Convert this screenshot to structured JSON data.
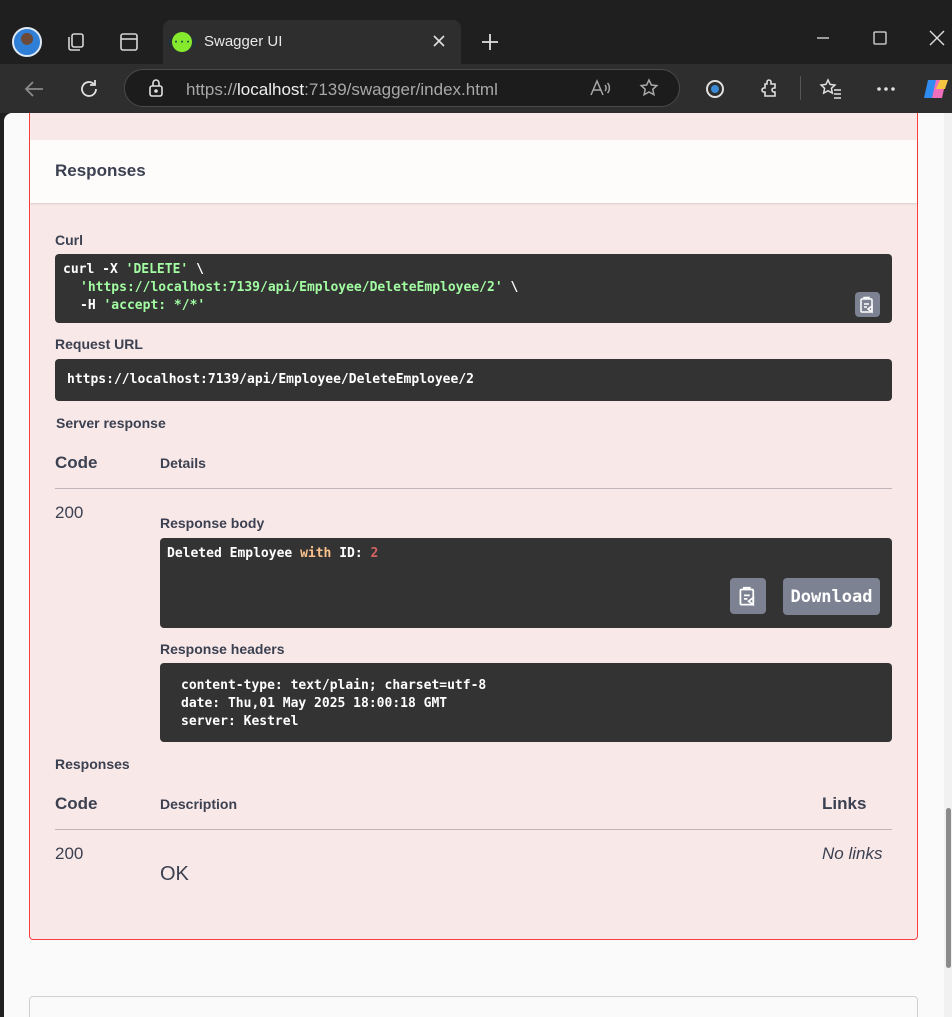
{
  "browser": {
    "tab_title": "Swagger UI",
    "tab_favicon_glyph": "{···}",
    "url_prefix": "https://",
    "url_host": "localhost",
    "url_rest": ":7139/swagger/index.html"
  },
  "page": {
    "section_title": "Responses",
    "curl": {
      "label": "Curl",
      "line1_cmd": "curl -X ",
      "line1_method": "'DELETE'",
      "line1_tail": " \\",
      "line2_url": "'https://localhost:7139/api/Employee/DeleteEmployee/2'",
      "line2_tail": " \\",
      "line3_flag": "-H ",
      "line3_header": "'accept: */*'"
    },
    "request_url": {
      "label": "Request URL",
      "value": "https://localhost:7139/api/Employee/DeleteEmployee/2"
    },
    "server_response": {
      "label": "Server response",
      "col_code": "Code",
      "col_details": "Details",
      "code": "200",
      "body_label": "Response body",
      "body_part1": "Deleted Employee ",
      "body_kw": "with",
      "body_part2": " ID: ",
      "body_num": "2",
      "download_label": "Download",
      "headers_label": "Response headers",
      "headers": [
        "content-type: text/plain; charset=utf-8",
        "date: Thu,01 May 2025 18:00:18 GMT",
        "server: Kestrel"
      ]
    },
    "responses": {
      "label": "Responses",
      "col_code": "Code",
      "col_description": "Description",
      "col_links": "Links",
      "code": "200",
      "description": "OK",
      "links": "No links"
    }
  }
}
